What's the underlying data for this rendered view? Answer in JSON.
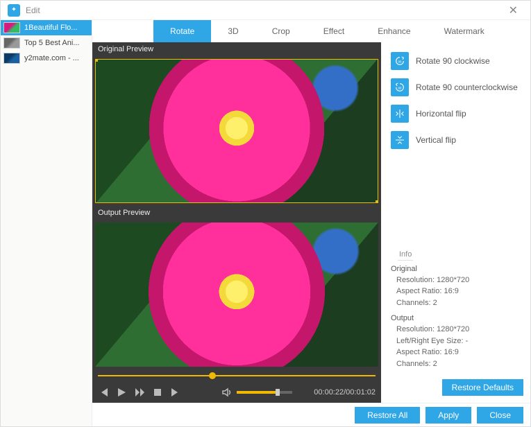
{
  "window": {
    "title": "Edit"
  },
  "sidebar": {
    "items": [
      {
        "label": "1Beautiful Flo..."
      },
      {
        "label": "Top 5 Best Ani..."
      },
      {
        "label": "y2mate.com - ..."
      }
    ]
  },
  "tabs": {
    "items": [
      {
        "label": "Rotate"
      },
      {
        "label": "3D"
      },
      {
        "label": "Crop"
      },
      {
        "label": "Effect"
      },
      {
        "label": "Enhance"
      },
      {
        "label": "Watermark"
      }
    ]
  },
  "previews": {
    "original_title": "Original Preview",
    "output_title": "Output Preview"
  },
  "player": {
    "current": "00:00:22",
    "total": "00:01:02"
  },
  "rotate_options": {
    "cw": "Rotate 90 clockwise",
    "ccw": "Rotate 90 counterclockwise",
    "hflip": "Horizontal flip",
    "vflip": "Vertical flip"
  },
  "info": {
    "heading": "Info",
    "original": {
      "title": "Original",
      "resolution_label": "Resolution:",
      "resolution": "1280*720",
      "aspect_label": "Aspect Ratio:",
      "aspect": "16:9",
      "channels_label": "Channels:",
      "channels": "2"
    },
    "output": {
      "title": "Output",
      "resolution_label": "Resolution:",
      "resolution": "1280*720",
      "eye_label": "Left/Right Eye Size:",
      "eye": "-",
      "aspect_label": "Aspect Ratio:",
      "aspect": "16:9",
      "channels_label": "Channels:",
      "channels": "2"
    }
  },
  "buttons": {
    "restore_defaults": "Restore Defaults",
    "restore_all": "Restore All",
    "apply": "Apply",
    "close": "Close"
  }
}
